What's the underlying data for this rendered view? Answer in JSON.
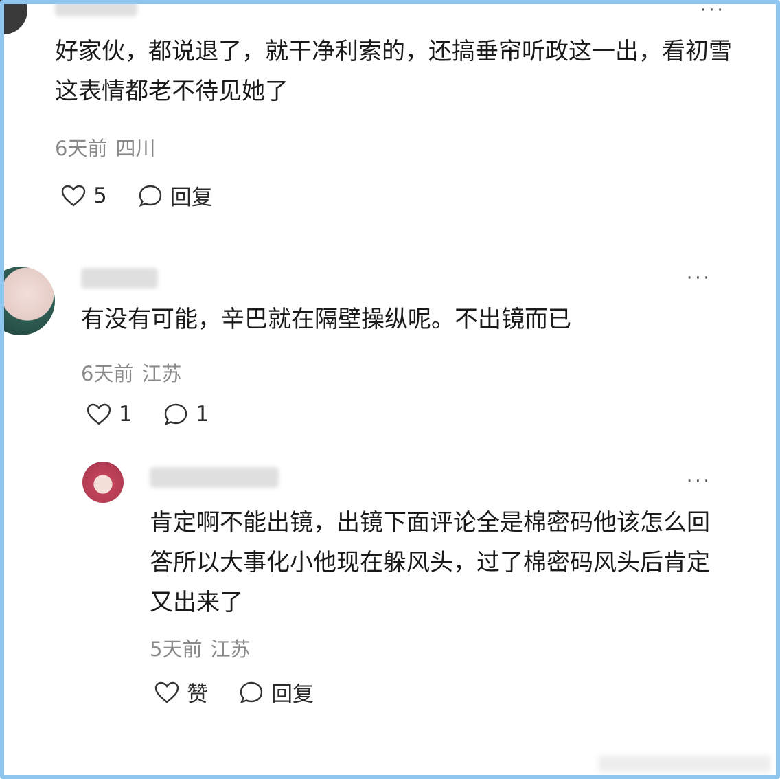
{
  "comments": [
    {
      "text": "好家伙，都说退了，就干净利索的，还搞垂帘听政这一出，看初雪这表情都老不待见她了",
      "time": "6天前",
      "location": "四川",
      "like": "5",
      "reply": "回复"
    },
    {
      "text": "有没有可能，辛巴就在隔壁操纵呢。不出镜而已",
      "time": "6天前",
      "location": "江苏",
      "like": "1",
      "reply": "1"
    },
    {
      "text": "肯定啊不能出镜，出镜下面评论全是棉密码他该怎么回答所以大事化小他现在躲风头，过了棉密码风头后肯定又出来了",
      "time": "5天前",
      "location": "江苏",
      "like": "赞",
      "reply": "回复"
    }
  ],
  "more_label": "···",
  "icons": [
    "heart-icon",
    "comment-bubble-icon"
  ]
}
